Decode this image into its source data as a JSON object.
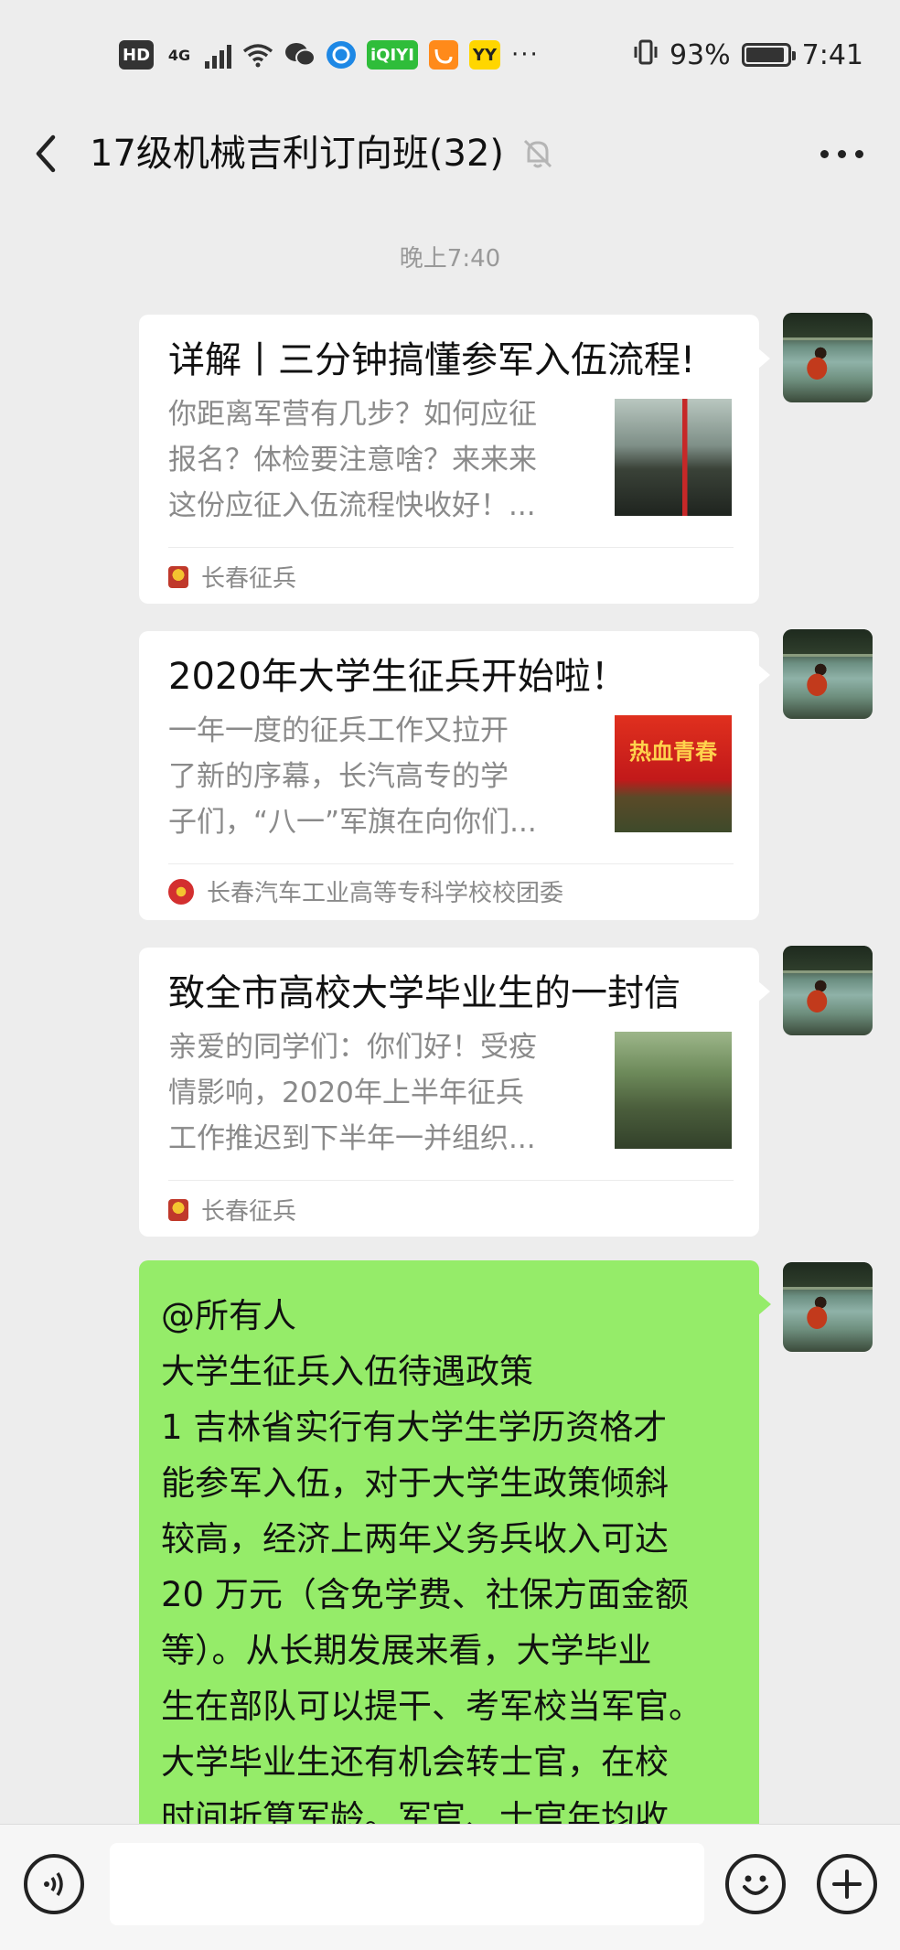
{
  "status_bar": {
    "hd": "HD",
    "network": "4G",
    "more": "···",
    "battery_percent": "93%",
    "battery_level": 0.93,
    "time": "7:41",
    "icons": [
      "hd-icon",
      "4g-icon",
      "signal-icon",
      "wifi-icon",
      "wechat-icon",
      "browser-icon",
      "iqiyi-icon",
      "uc-icon",
      "yy-icon",
      "vibrate-icon",
      "battery-icon"
    ],
    "iqiyi_label": "iQIYI",
    "yy_label": "YY"
  },
  "header": {
    "title": "17级机械吉利订向班(32)",
    "back_icon": "chevron-left-icon",
    "mute_icon": "bell-off-icon",
    "more_icon": "more-horizontal-icon"
  },
  "timestamp": "晚上7:40",
  "messages": [
    {
      "type": "link_card",
      "title": "详解丨三分钟搞懂参军入伍流程!",
      "desc_lines": [
        "你距离军营有几步？如何应征",
        "报名？体检要注意啥？来来来",
        "这份应征入伍流程快收好！..."
      ],
      "source": "长春征兵"
    },
    {
      "type": "link_card",
      "title": "2020年大学生征兵开始啦！",
      "desc_lines": [
        "一年一度的征兵工作又拉开",
        "了新的序幕，长汽高专的学",
        "子们，“八一”军旗在向你们..."
      ],
      "source": "长春汽车工业高等专科学校校团委",
      "thumb_text": "热血青春"
    },
    {
      "type": "link_card",
      "title": "致全市高校大学毕业生的一封信",
      "desc_lines": [
        "亲爱的同学们：你们好！受疫",
        "情影响，2020年上半年征兵",
        "工作推迟到下半年一并组织..."
      ],
      "source": "长春征兵"
    },
    {
      "type": "text",
      "lines": [
        "@所有人",
        "大学生征兵入伍待遇政策",
        "1 吉林省实行有大学生学历资格才",
        "能参军入伍，对于大学生政策倾斜",
        "较高，经济上两年义务兵收入可达",
        "20 万元（含免学费、社保方面金额",
        "等）。从长期发展来看，大学毕业",
        "生在部队可以提干、考军校当军官。",
        "大学毕业生还有机会转士官，在校",
        "时间折算军龄。军官、士官年均收"
      ]
    }
  ],
  "input_bar": {
    "voice_icon": "voice-icon",
    "emoji_icon": "emoji-icon",
    "plus_icon": "plus-circle-icon",
    "input_value": ""
  },
  "colors": {
    "background": "#ededed",
    "bubble_green": "#95ec69",
    "card": "#ffffff",
    "muted_text": "#8a8a8a"
  }
}
